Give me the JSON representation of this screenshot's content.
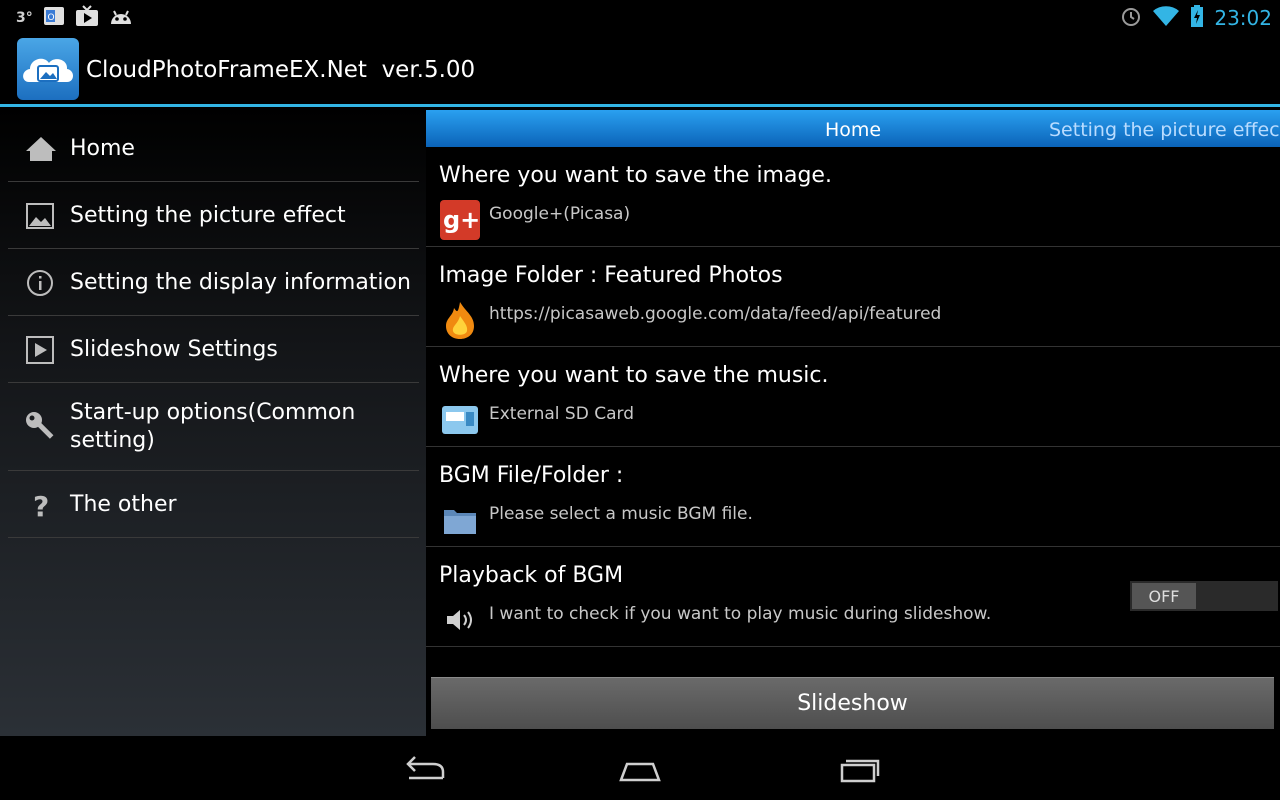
{
  "status_bar": {
    "temperature": "3°",
    "time": "23:02",
    "icons_left": [
      "outlook-icon",
      "tv-icon",
      "android-icon"
    ],
    "icons_right": [
      "alarm-icon",
      "wifi-icon",
      "battery-icon"
    ],
    "accent_color": "#33b5e5"
  },
  "app": {
    "title": "CloudPhotoFrameEX.Net  ver.5.00"
  },
  "nav": {
    "items": [
      {
        "label": "Home",
        "icon": "home-icon"
      },
      {
        "label": "Setting the picture effect",
        "icon": "image-icon"
      },
      {
        "label": "Setting the display information",
        "icon": "info-icon"
      },
      {
        "label": "Slideshow Settings",
        "icon": "play-icon"
      },
      {
        "label": "Start-up options(Common setting)",
        "icon": "key-icon"
      },
      {
        "label": "The other",
        "icon": "question-icon"
      }
    ]
  },
  "tabs": {
    "current": "Home",
    "next": "Setting the picture effect"
  },
  "settings": [
    {
      "title": "Where you want to save the image.",
      "value": "Google+(Picasa)",
      "icon": "google-plus-icon"
    },
    {
      "title": "Image Folder : Featured Photos",
      "value": "https://picasaweb.google.com/data/feed/api/featured",
      "icon": "fire-icon"
    },
    {
      "title": "Where you want to save the music.",
      "value": "External SD Card",
      "icon": "sd-card-icon"
    },
    {
      "title": "BGM File/Folder :",
      "value": "Please select a music BGM file.",
      "icon": "folder-icon"
    },
    {
      "title": "Playback of BGM",
      "value": "I want to check if you want to play music during slideshow.",
      "icon": "speaker-icon",
      "toggle": "OFF"
    }
  ],
  "slideshow_button": "Slideshow",
  "system_nav": [
    "back-icon",
    "home-icon",
    "recents-icon"
  ]
}
